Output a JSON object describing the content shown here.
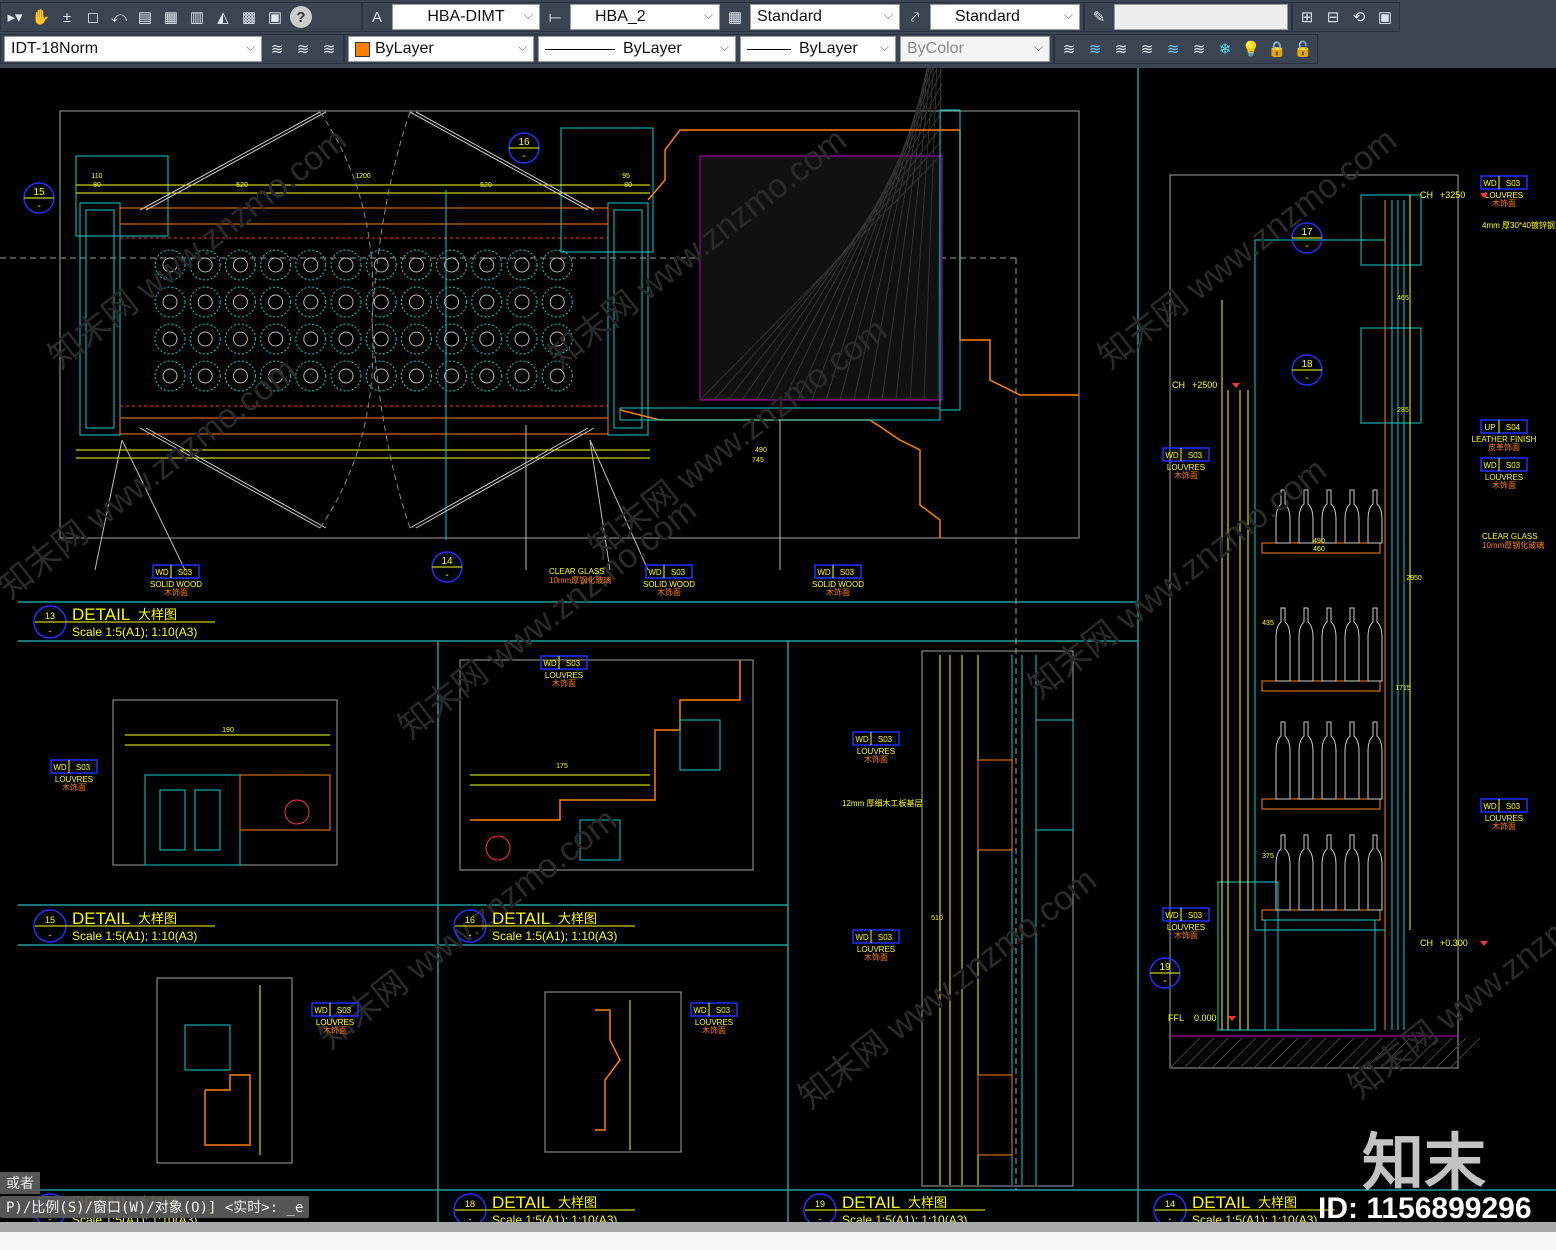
{
  "toolbar": {
    "row1": {
      "text_style": "HBA-DIMT",
      "dim_style": "HBA_2",
      "table_style": "Standard",
      "mleader_style": "Standard",
      "blank_field": ""
    },
    "row2": {
      "layer": "IDT-18Norm",
      "color": "ByLayer",
      "color_swatch": "#ff7f00",
      "linetype": "ByLayer",
      "lineweight": "ByLayer",
      "plotstyle": "ByColor"
    },
    "icons": [
      "arrow-icon",
      "pan-hand-icon",
      "zoom-realtime-icon",
      "zoom-window-icon",
      "zoom-previous-icon",
      "properties-icon",
      "design-center-icon",
      "tool-palette-icon",
      "sheet-set-icon",
      "markup-icon",
      "quickcalc-icon",
      "help-icon",
      "text-style-icon",
      "dim-style-icon",
      "table-style-icon",
      "mleader-style-icon",
      "named-view-icon",
      "layer-icons"
    ]
  },
  "canvas": {
    "colors": {
      "bg": "#000000",
      "frame": "#1f9e9e",
      "yellow": "#ffff00",
      "cyan": "#00d0d0",
      "orange": "#ff8000",
      "magenta": "#c000c0",
      "blue": "#2030ff",
      "gray": "#a0a0a0"
    },
    "details": [
      {
        "num": "13",
        "sub": "-",
        "title": "DETAIL",
        "cn": "大样图",
        "scale": "Scale 1:5(A1); 1:10(A3)"
      },
      {
        "num": "15",
        "sub": "-",
        "title": "DETAIL",
        "cn": "大样图",
        "scale": "Scale 1:5(A1); 1:10(A3)"
      },
      {
        "num": "16",
        "sub": "-",
        "title": "DETAIL",
        "cn": "大样图",
        "scale": "Scale 1:5(A1); 1:10(A3)"
      },
      {
        "num": "",
        "sub": "-",
        "title": "DETAIL",
        "cn": "大样图",
        "scale": "Scale 1:5(A1); 1:10(A3)"
      },
      {
        "num": "18",
        "sub": "-",
        "title": "DETAIL",
        "cn": "大样图",
        "scale": "Scale 1:5(A1); 1:10(A3)"
      },
      {
        "num": "19",
        "sub": "-",
        "title": "DETAIL",
        "cn": "大样图",
        "scale": "Scale 1:5(A1); 1:10(A3)"
      },
      {
        "num": "14",
        "sub": "-",
        "title": "DETAIL",
        "cn": "大样图",
        "scale": "Scale 1:5(A1); 1:10(A3)"
      }
    ],
    "callouts": [
      {
        "num": "15",
        "sub": "-"
      },
      {
        "num": "16",
        "sub": "-"
      },
      {
        "num": "14",
        "sub": "-"
      },
      {
        "num": "17",
        "sub": "-"
      },
      {
        "num": "18",
        "sub": "-"
      },
      {
        "num": "19",
        "sub": "-"
      }
    ],
    "tags": [
      {
        "code": "WD",
        "num": "S03",
        "l1": "SOLID WOOD",
        "l2": "木饰面"
      },
      {
        "code": "WD",
        "num": "S03",
        "l1": "SOLID WOOD",
        "l2": "木饰面"
      },
      {
        "code": "WD",
        "num": "S03",
        "l1": "SOLID WOOD",
        "l2": "木饰面"
      },
      {
        "code": "WD",
        "num": "S03",
        "l1": "LOUVRES",
        "l2": "木饰面"
      },
      {
        "code": "WD",
        "num": "S03",
        "l1": "LOUVRES",
        "l2": "木饰面"
      },
      {
        "code": "WD",
        "num": "S03",
        "l1": "LOUVRES",
        "l2": "木饰面"
      },
      {
        "code": "WD",
        "num": "S03",
        "l1": "LOUVRES",
        "l2": "木饰面"
      },
      {
        "code": "WD",
        "num": "S03",
        "l1": "LOUVRES",
        "l2": "木饰面"
      },
      {
        "code": "WD",
        "num": "S03",
        "l1": "LOUVRES",
        "l2": "木饰面"
      },
      {
        "code": "WD",
        "num": "S03",
        "l1": "LOUVRES",
        "l2": "木饰面"
      },
      {
        "code": "WD",
        "num": "S03",
        "l1": "LOUVRES",
        "l2": "木饰面"
      },
      {
        "code": "UP",
        "num": "S04",
        "l1": "LEATHER FINISH",
        "l2": "皮革饰面"
      },
      {
        "code": "WD",
        "num": "S03",
        "l1": "LOUVRES",
        "l2": "木饰面"
      },
      {
        "code": "WD",
        "num": "S03",
        "l1": "LOUVRES",
        "l2": "木饰面"
      },
      {
        "code": "WD",
        "num": "S03",
        "l1": "LOUVRES",
        "l2": "木饰面"
      }
    ],
    "notes": [
      {
        "l1": "CLEAR GLASS",
        "l2": "10mm厚钢化玻璃"
      },
      {
        "l1": "CLEAR GLASS",
        "l2": "10mm厚钢化玻璃"
      },
      {
        "l1": "12mm 厚细木工板基层",
        "l2": ""
      },
      {
        "l1": "4mm 厚30*40镀锌钢方管",
        "l2": ""
      }
    ],
    "levels": [
      {
        "tag": "CH",
        "val": "+3250"
      },
      {
        "tag": "CH",
        "val": "+2500"
      },
      {
        "tag": "CH",
        "val": "+0.300"
      },
      {
        "tag": "FFL",
        "val": "0.000"
      }
    ],
    "dims": {
      "d1": "110",
      "d2": "80",
      "d3": "520",
      "d4": "1200",
      "d5": "520",
      "d6": "95",
      "d7": "80",
      "d8": "490",
      "d9": "745",
      "d10": "2950",
      "d11": "1715",
      "d12": "465",
      "d13": "285",
      "d14": "435",
      "d15": "375",
      "d16": "490",
      "d17": "460",
      "d18": "190",
      "d19": "175",
      "d20": "510"
    }
  },
  "command": {
    "hint": "或者",
    "line": "P)/比例(S)/窗口(W)/对象(O)] <实时>: _e"
  },
  "watermark": {
    "logo": "知末",
    "id": "ID: 1156899296",
    "url": "知末网 www.znzmo.com"
  }
}
